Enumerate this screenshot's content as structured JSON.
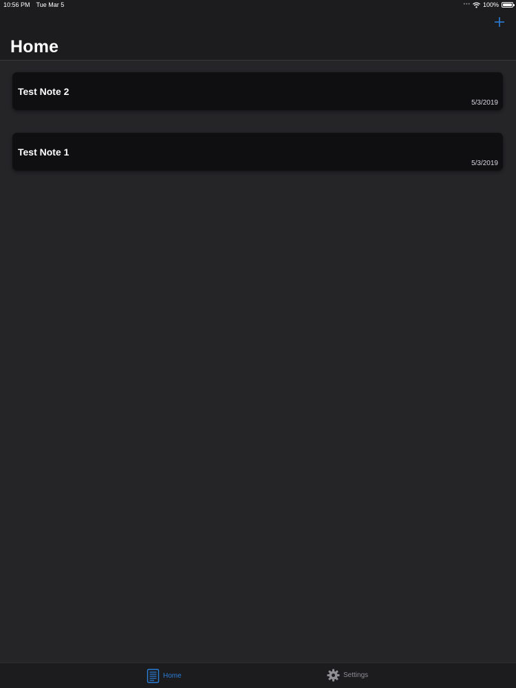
{
  "status_bar": {
    "time": "10:56 PM",
    "date": "Tue Mar 5",
    "battery": "100%",
    "icons": [
      "wifi-icon",
      "battery-icon"
    ]
  },
  "nav": {
    "title": "Home",
    "add_icon": "plus-icon"
  },
  "notes": [
    {
      "title": "Test Note 2",
      "date": "5/3/2019"
    },
    {
      "title": "Test Note 1",
      "date": "5/3/2019"
    }
  ],
  "tabs": [
    {
      "label": "Home",
      "icon": "notes-icon",
      "selected": true
    },
    {
      "label": "Settings",
      "icon": "gear-icon",
      "selected": false
    }
  ],
  "colors": {
    "background": "#252427",
    "bar": "#1c1c1e",
    "card": "#0f0e11",
    "accent": "#2b7fd9",
    "inactive": "#8e8e93"
  }
}
